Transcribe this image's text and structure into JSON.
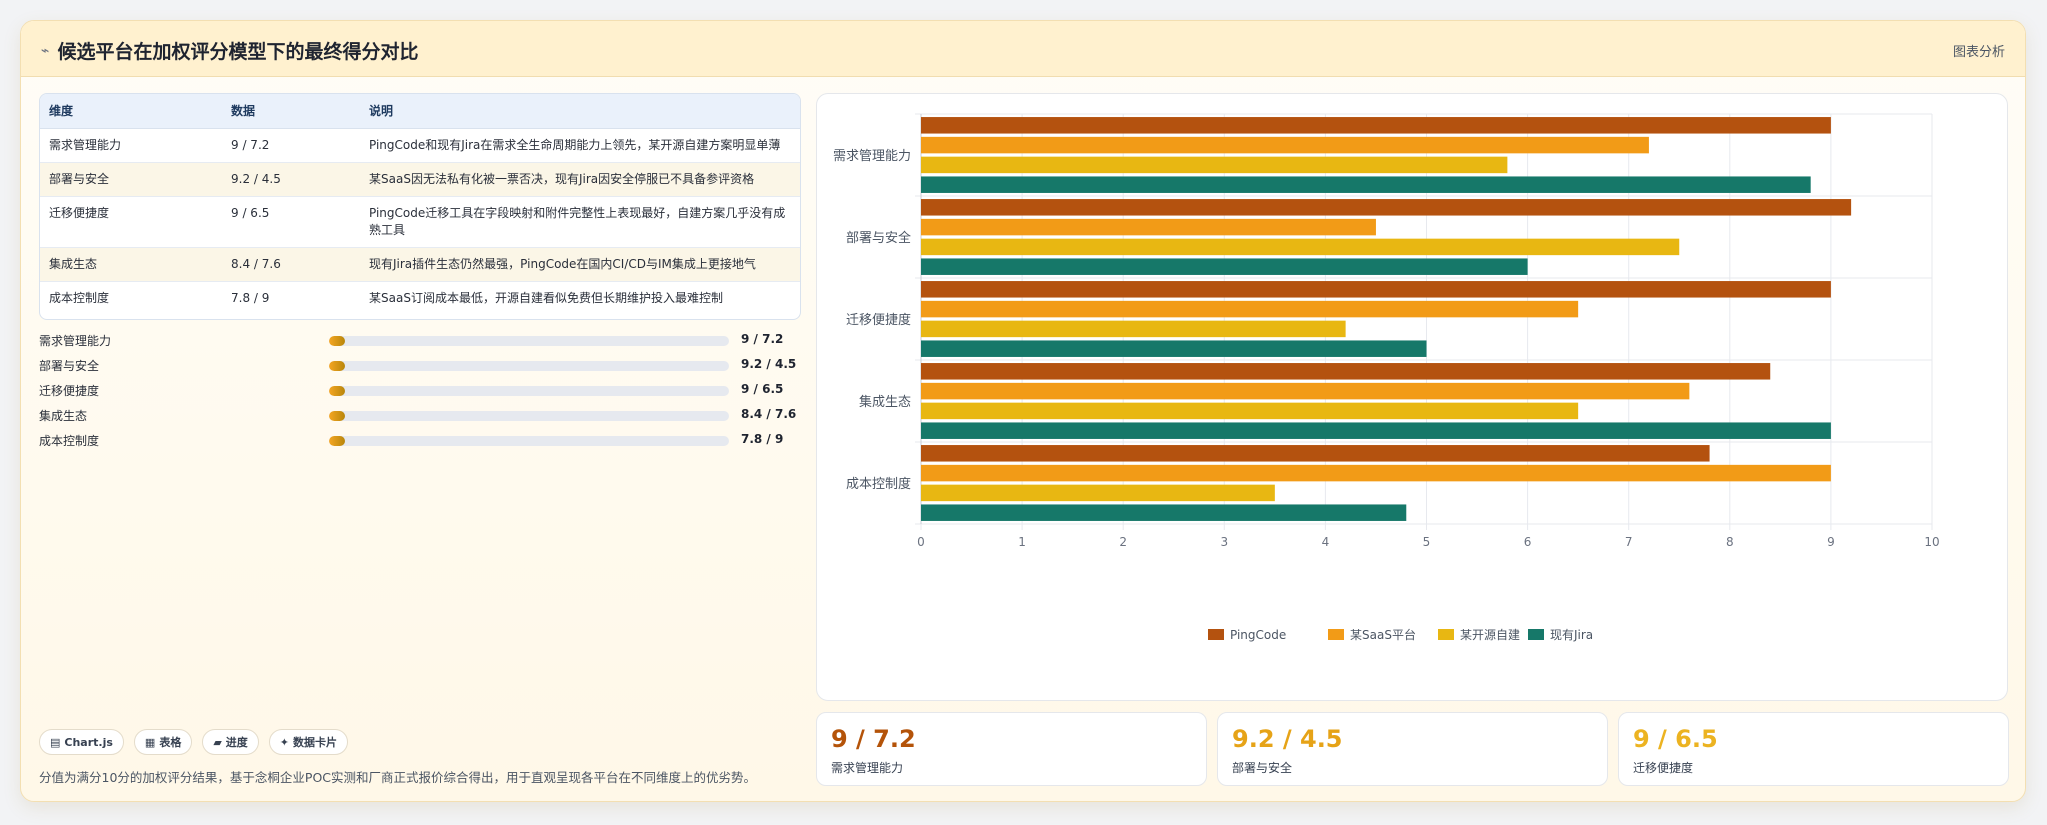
{
  "header": {
    "icon": "chart-line-icon",
    "title": "候选平台在加权评分模型下的最终得分对比",
    "link": "图表分析"
  },
  "table": {
    "columns": [
      "维度",
      "数据",
      "说明"
    ],
    "rows": [
      [
        "需求管理能力",
        "9 / 7.2",
        "PingCode和现有Jira在需求全生命周期能力上领先，某开源自建方案明显单薄"
      ],
      [
        "部署与安全",
        "9.2 / 4.5",
        "某SaaS因无法私有化被一票否决，现有Jira因安全停服已不具备参评资格"
      ],
      [
        "迁移便捷度",
        "9 / 6.5",
        "PingCode迁移工具在字段映射和附件完整性上表现最好，自建方案几乎没有成熟工具"
      ],
      [
        "集成生态",
        "8.4 / 7.6",
        "现有Jira插件生态仍然最强，PingCode在国内CI/CD与IM集成上更接地气"
      ],
      [
        "成本控制度",
        "7.8 / 9",
        "某SaaS订阅成本最低，开源自建看似免费但长期维护投入最难控制"
      ]
    ]
  },
  "progress": [
    {
      "label": "需求管理能力",
      "value": "9 / 7.2",
      "fill": 0.04
    },
    {
      "label": "部署与安全",
      "value": "9.2 / 4.5",
      "fill": 0.04
    },
    {
      "label": "迁移便捷度",
      "value": "9 / 6.5",
      "fill": 0.04
    },
    {
      "label": "集成生态",
      "value": "8.4 / 7.6",
      "fill": 0.04
    },
    {
      "label": "成本控制度",
      "value": "7.8 / 9",
      "fill": 0.04
    }
  ],
  "chips": [
    {
      "icon": "chart-icon",
      "glyph": "▤",
      "label": "Chart.js"
    },
    {
      "icon": "table-icon",
      "glyph": "▦",
      "label": "表格"
    },
    {
      "icon": "progress-icon",
      "glyph": "▰",
      "label": "进度"
    },
    {
      "icon": "card-icon",
      "glyph": "✦",
      "label": "数据卡片"
    }
  ],
  "footer_note": "分值为满分10分的加权评分结果，基于念桐企业POC实测和厂商正式报价综合得出，用于直观呈现各平台在不同维度上的优劣势。",
  "stats": [
    {
      "value": "9 / 7.2",
      "label": "需求管理能力",
      "color": "#b45309"
    },
    {
      "value": "9.2 / 4.5",
      "label": "部署与安全",
      "color": "#e6a317"
    },
    {
      "value": "9 / 6.5",
      "label": "迁移便捷度",
      "color": "#ecb321"
    }
  ],
  "chart_data": {
    "type": "bar",
    "orientation": "horizontal",
    "categories": [
      "需求管理能力",
      "部署与安全",
      "迁移便捷度",
      "集成生态",
      "成本控制度"
    ],
    "series": [
      {
        "name": "PingCode",
        "color": "#b4520f",
        "values": [
          9,
          9.2,
          9,
          8.4,
          7.8
        ]
      },
      {
        "name": "某SaaS平台",
        "color": "#f29b17",
        "values": [
          7.2,
          4.5,
          6.5,
          7.6,
          9
        ]
      },
      {
        "name": "某开源自建",
        "color": "#e8b712",
        "values": [
          5.8,
          7.5,
          4.2,
          6.5,
          3.5
        ]
      },
      {
        "name": "现有Jira",
        "color": "#167869",
        "values": [
          8.8,
          6,
          5,
          9,
          4.8
        ]
      }
    ],
    "xlim": [
      0,
      10
    ],
    "xticks": [
      0,
      1,
      2,
      3,
      4,
      5,
      6,
      7,
      8,
      9,
      10
    ],
    "grid": true,
    "legend": "bottom"
  }
}
